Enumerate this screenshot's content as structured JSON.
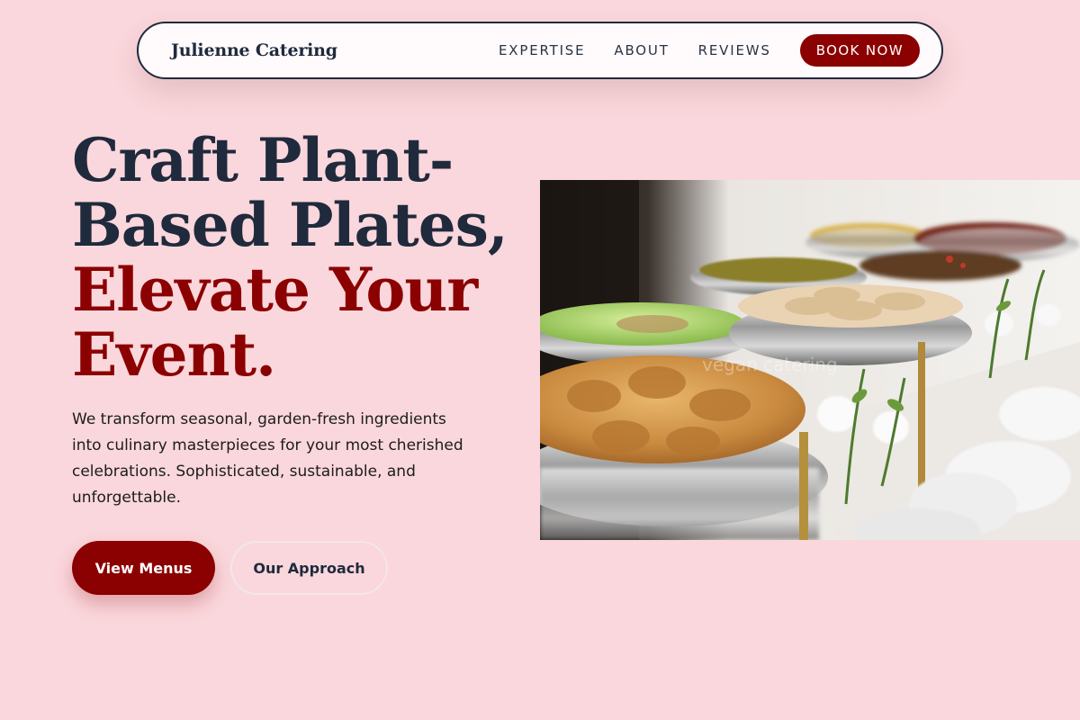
{
  "nav": {
    "brand": "Julienne Catering",
    "links": [
      "EXPERTISE",
      "ABOUT",
      "REVIEWS"
    ],
    "cta": "BOOK NOW"
  },
  "hero": {
    "headline_line1": "Craft Plant-",
    "headline_line2": "Based Plates,",
    "headline_accent1": "Elevate Your",
    "headline_accent2": "Event.",
    "description": "We transform seasonal, garden-fresh ingredients into culinary masterpieces for your most cherished celebrations. Sophisticated, sustainable, and unforgettable.",
    "primary_button": "View Menus",
    "secondary_button": "Our Approach",
    "image_watermark": "vegan catering"
  },
  "colors": {
    "background": "#fad7dc",
    "accent": "#8b0000",
    "text_dark": "#1f2a3c"
  }
}
